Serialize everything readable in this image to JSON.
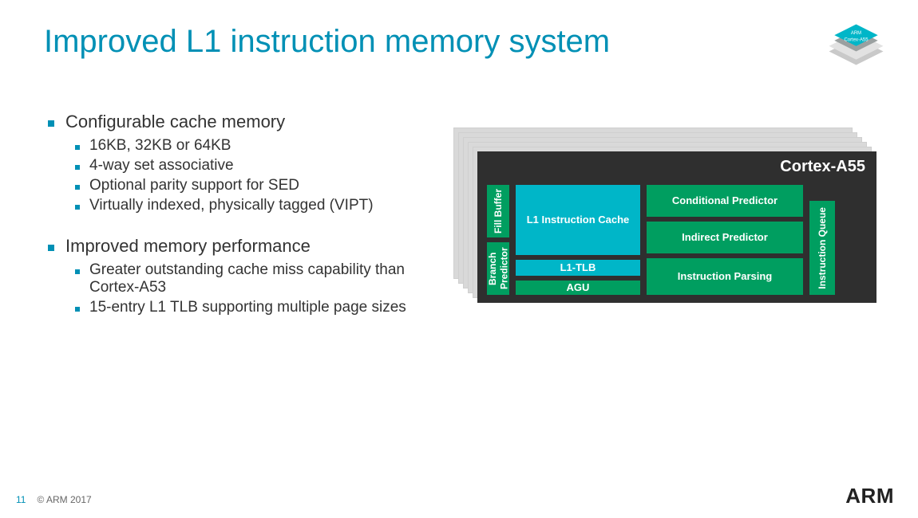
{
  "title": "Improved L1 instruction memory system",
  "badge_line1": "ARM",
  "badge_line2": "Cortex-A55",
  "bullets": {
    "b1": "Configurable cache memory",
    "b1a": "16KB, 32KB or 64KB",
    "b1b": "4-way set associative",
    "b1c": "Optional parity support for SED",
    "b1d": "Virtually indexed, physically tagged (VIPT)",
    "b2": "Improved memory performance",
    "b2a": "Greater outstanding cache miss capability than Cortex-A53",
    "b2b": "15-entry L1 TLB supporting multiple page sizes"
  },
  "diagram": {
    "slab_title": "Cortex-A55",
    "fill_buffer": "Fill Buffer",
    "branch_predictor": "Branch Predictor",
    "l1_icache": "L1 Instruction Cache",
    "l1_tlb": "L1-TLB",
    "agu": "AGU",
    "cond_pred": "Conditional Predictor",
    "indirect_pred": "Indirect Predictor",
    "inst_parse": "Instruction Parsing",
    "inst_queue": "Instruction Queue"
  },
  "footer": {
    "page": "11",
    "copyright": "© ARM 2017"
  },
  "brand": "ARM"
}
